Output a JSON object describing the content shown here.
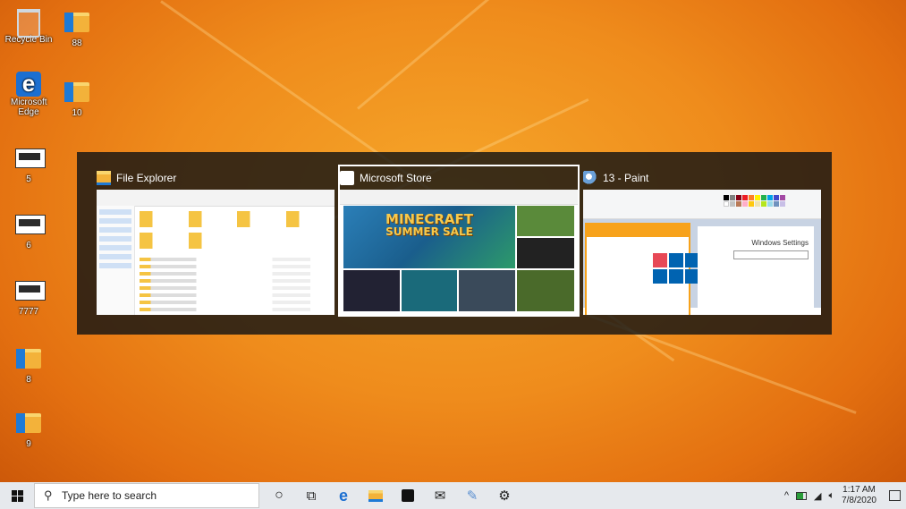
{
  "desktop": {
    "icons": [
      {
        "label": "Recycle Bin"
      },
      {
        "label": "88"
      },
      {
        "label": "Microsoft Edge"
      },
      {
        "label": "10"
      },
      {
        "label": "5"
      },
      {
        "label": "6"
      },
      {
        "label": "7777"
      },
      {
        "label": "8"
      },
      {
        "label": "9"
      }
    ]
  },
  "switcher": {
    "windows": [
      {
        "title": "File Explorer",
        "selected": false
      },
      {
        "title": "Microsoft Store",
        "selected": true,
        "hero_text": "MINECRAFT",
        "hero_sub": "SUMMER SALE"
      },
      {
        "title": "13 - Paint",
        "selected": false,
        "settings_title": "Windows Settings"
      }
    ]
  },
  "taskbar": {
    "search_placeholder": "Type here to search",
    "clock_time": "1:17 AM",
    "clock_date": "7/8/2020",
    "icons": [
      "start-icon",
      "cortana-icon",
      "task-view-icon",
      "edge-icon",
      "file-explorer-icon",
      "store-icon",
      "mail-icon",
      "paint-icon",
      "settings-icon"
    ]
  },
  "colors": {
    "wallpaper": "#ef8c1c",
    "switcher_bg": "#141414",
    "taskbar_bg": "#e6e9ed",
    "accent": "#0063b1"
  }
}
